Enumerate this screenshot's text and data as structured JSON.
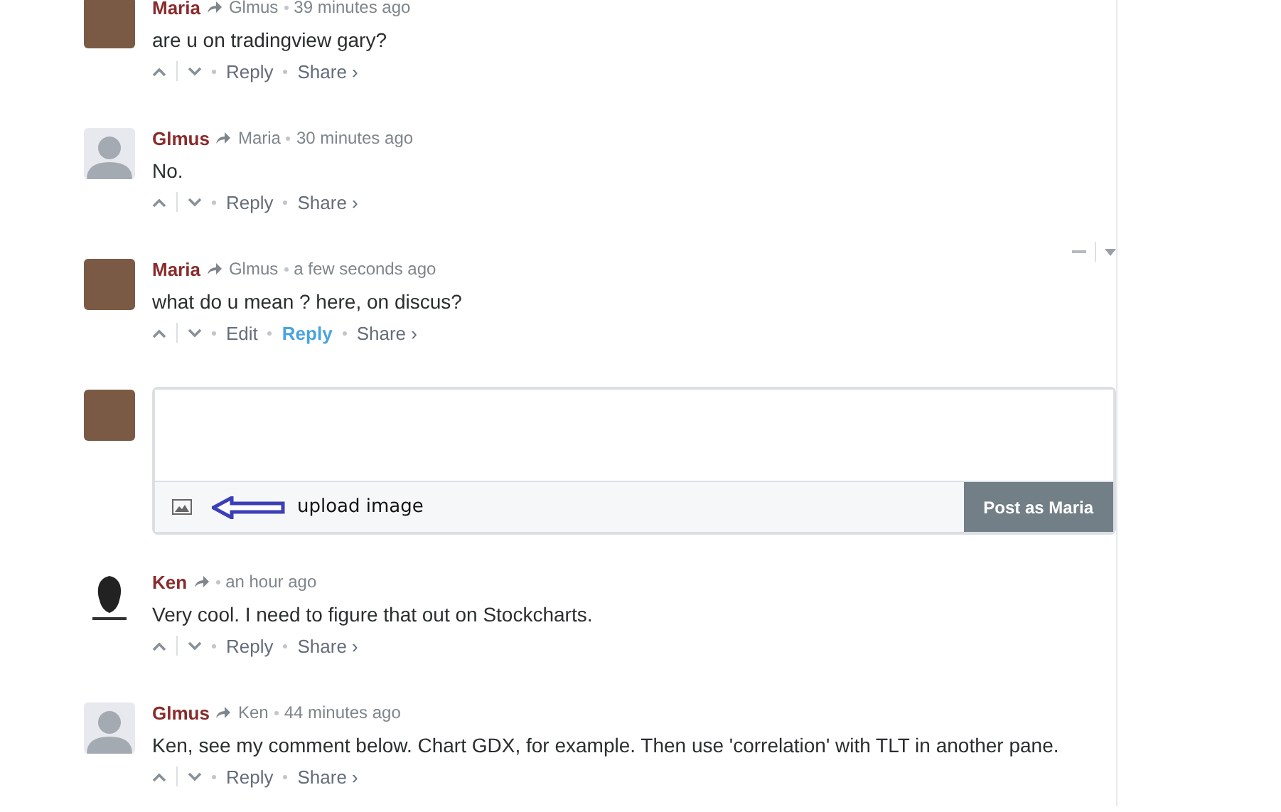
{
  "comments": [
    {
      "author": "Maria",
      "reply_to": "Glmus",
      "time": "39 minutes ago",
      "avatar": {
        "kind": "photo"
      },
      "text": "are u on tradingview gary?",
      "actions": [
        {
          "label": "Reply",
          "highlighted": false
        },
        {
          "label": "Share ›",
          "highlighted": false
        }
      ],
      "menu": false
    },
    {
      "author": "Glmus",
      "reply_to": "Maria",
      "time": "30 minutes ago",
      "avatar": {
        "kind": "default"
      },
      "text": "No.",
      "actions": [
        {
          "label": "Reply",
          "highlighted": false
        },
        {
          "label": "Share ›",
          "highlighted": false
        }
      ],
      "menu": false
    },
    {
      "author": "Maria",
      "reply_to": "Glmus",
      "time": "a few seconds ago",
      "avatar": {
        "kind": "photo"
      },
      "text": "what do u mean ? here, on discus?",
      "actions": [
        {
          "label": "Edit",
          "highlighted": false
        },
        {
          "label": "Reply",
          "highlighted": true
        },
        {
          "label": "Share ›",
          "highlighted": false
        }
      ],
      "menu": true
    }
  ],
  "composer": {
    "avatar": {
      "kind": "photo"
    },
    "annotation": "upload image",
    "post_button": "Post as Maria"
  },
  "replies": [
    {
      "author": "Ken",
      "time": "an hour ago",
      "avatar": {
        "kind": "logo"
      },
      "text": "Very cool. I need to figure that out on Stockcharts.",
      "actions": [
        {
          "label": "Reply",
          "highlighted": false
        },
        {
          "label": "Share ›",
          "highlighted": false
        }
      ],
      "menu": false
    },
    {
      "author": "Glmus",
      "reply_to": "Ken",
      "time": "44 minutes ago",
      "avatar": {
        "kind": "default"
      },
      "text": "Ken, see my comment below. Chart GDX, for example. Then use 'correlation' with TLT in another pane.",
      "actions": [
        {
          "label": "Reply",
          "highlighted": false
        },
        {
          "label": "Share ›",
          "highlighted": false
        }
      ],
      "menu": false
    }
  ]
}
